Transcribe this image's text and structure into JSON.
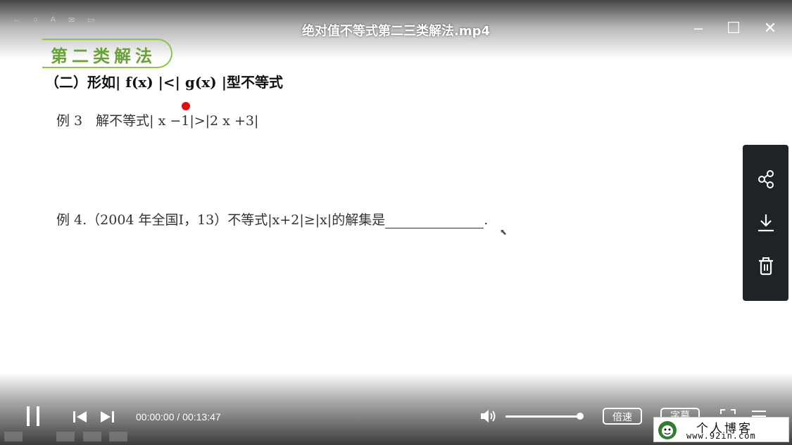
{
  "window": {
    "title": "绝对值不等式第二三类解法.mp4"
  },
  "slide": {
    "section_banner": "第二类解法",
    "subtitle": "（二）形如| f(x) |<| g(x) |型不等式",
    "example3": "例 3　解不等式| x −1|>|2 x +3|",
    "example4_prefix": "例 4.（2004 年全国I，13）不等式|x+2|≥|x|的解集是",
    "example4_suffix": "."
  },
  "side_panel": {
    "share_icon": "share-icon",
    "download_icon": "download-icon",
    "delete_icon": "trash-icon"
  },
  "player": {
    "time_display": "00:00:00 / 00:13:47",
    "speed_label": "倍速",
    "subtitle_label": "字幕",
    "volume_level": 1.0
  },
  "watermark": {
    "cn_text": "个人博客",
    "url_text": "www.92in.com"
  }
}
